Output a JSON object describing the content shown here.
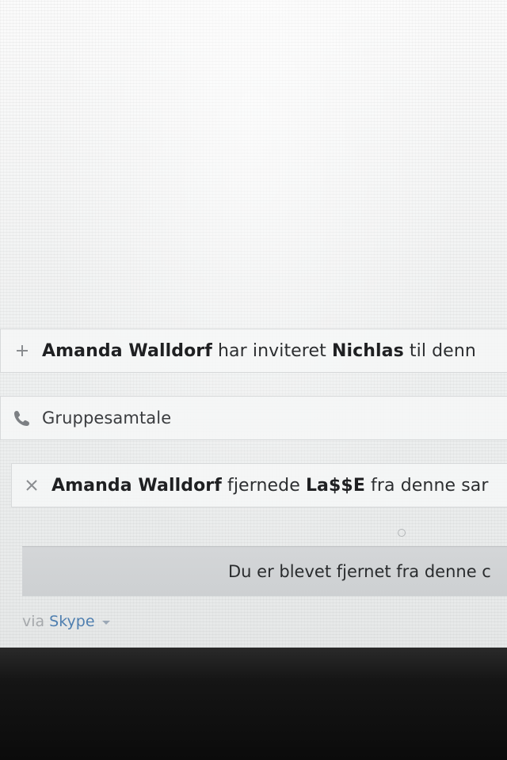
{
  "events": {
    "invite": {
      "icon": "plus-icon",
      "actor": "Amanda Walldorf",
      "action": "har inviteret",
      "target": "Nichlas",
      "suffix": "til denn"
    },
    "call": {
      "icon": "phone-icon",
      "label": "Gruppesamtale"
    },
    "removed": {
      "icon": "close-icon",
      "actor": "Amanda Walldorf",
      "action": "fjernede",
      "target": "La$$E",
      "suffix": "fra denne sar"
    }
  },
  "notice": {
    "text": "Du er blevet fjernet fra denne c"
  },
  "footer": {
    "via_label": "via",
    "service": "Skype",
    "caret_icon": "chevron-down-icon"
  },
  "colors": {
    "link": "#4f7fb0",
    "notice_bg": "#d0d3d5"
  }
}
